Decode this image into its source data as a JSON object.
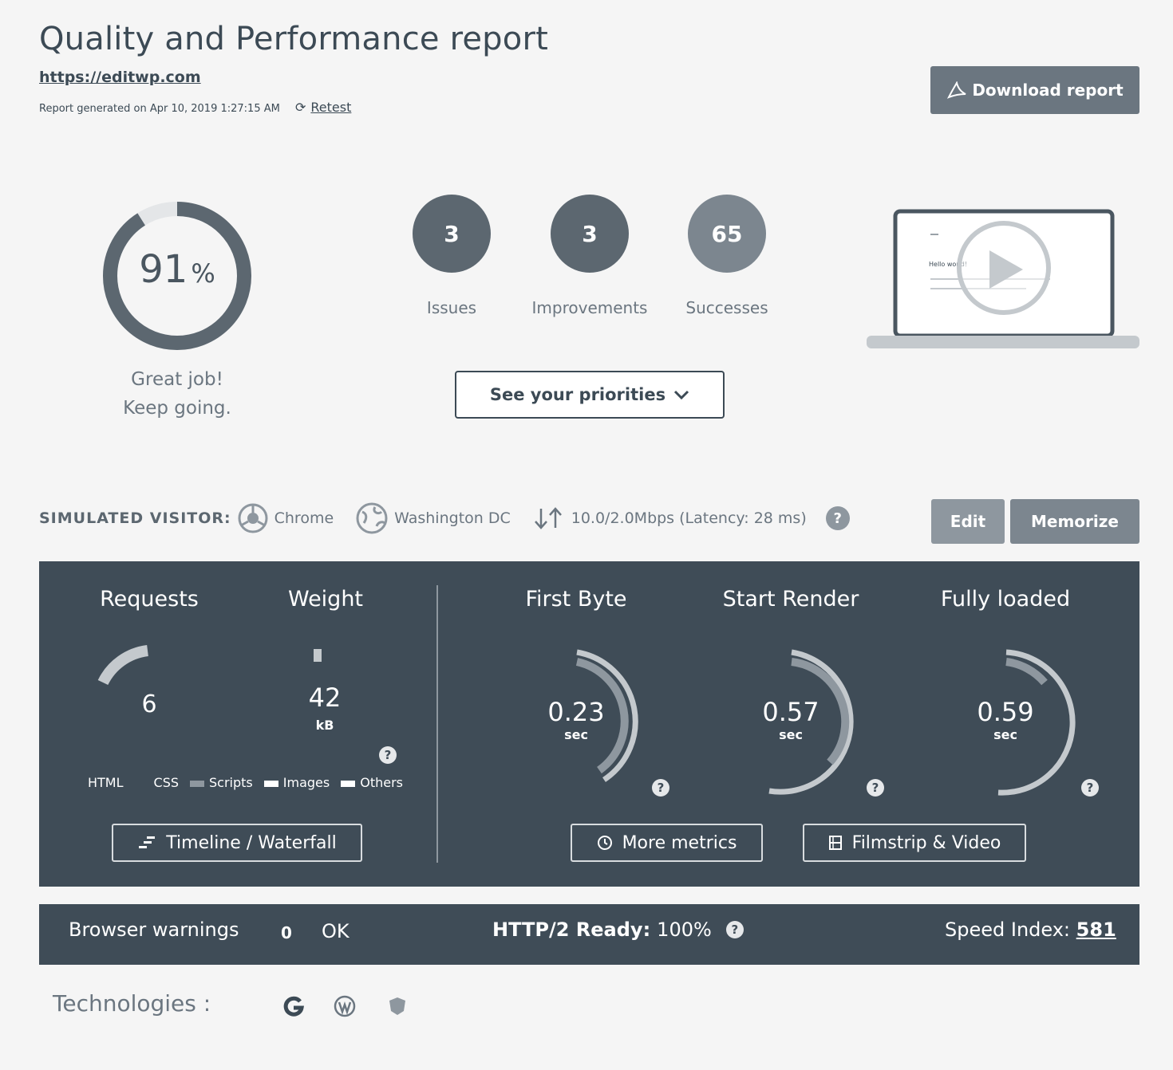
{
  "header": {
    "title": "Quality and Performance report",
    "url": "https://editwp.com",
    "generated": "Report generated on Apr 10, 2019 1:27:15 AM",
    "retest_label": "Retest",
    "download_label": "Download report"
  },
  "score": {
    "value": "91",
    "percent_sign": "%",
    "progress": 0.91,
    "message_line1": "Great job!",
    "message_line2": "Keep going."
  },
  "counters": [
    {
      "value": "3",
      "label": "Issues"
    },
    {
      "value": "3",
      "label": "Improvements"
    },
    {
      "value": "65",
      "label": "Successes"
    }
  ],
  "priorities_label": "See your priorities",
  "laptop_screen_text": "Hello world!",
  "visitor": {
    "label": "SIMULATED VISITOR:",
    "browser": "Chrome",
    "location": "Washington DC",
    "connection": "10.0/2.0Mbps (Latency: 28 ms)",
    "help": "?",
    "edit_label": "Edit",
    "memorize_label": "Memorize"
  },
  "metrics": {
    "requests": {
      "title": "Requests",
      "value": "6"
    },
    "weight": {
      "title": "Weight",
      "value": "42",
      "unit": "kB"
    },
    "legend": [
      "HTML",
      "CSS",
      "Scripts",
      "Images",
      "Others"
    ],
    "first_byte": {
      "title": "First Byte",
      "value": "0.23",
      "unit": "sec"
    },
    "start_render": {
      "title": "Start Render",
      "value": "0.57",
      "unit": "sec"
    },
    "fully_loaded": {
      "title": "Fully loaded",
      "value": "0.59",
      "unit": "sec"
    },
    "help": "?",
    "timeline_label": "Timeline / Waterfall",
    "more_metrics_label": "More metrics",
    "filmstrip_label": "Filmstrip & Video"
  },
  "status": {
    "browser_warnings_label": "Browser warnings",
    "browser_warnings_count": "0",
    "browser_warnings_status": "OK",
    "http2_label": "HTTP/2 Ready:",
    "http2_value": "100%",
    "help": "?",
    "speed_index_label": "Speed Index:",
    "speed_index_value": "581"
  },
  "technologies": {
    "label": "Technologies :",
    "icons": [
      "google-icon",
      "wordpress-icon",
      "shield-icon"
    ]
  },
  "colors": {
    "dark": "#3f4c57",
    "text": "#3c4a55",
    "muted": "#6b7680",
    "light_gray": "#8e979f"
  }
}
